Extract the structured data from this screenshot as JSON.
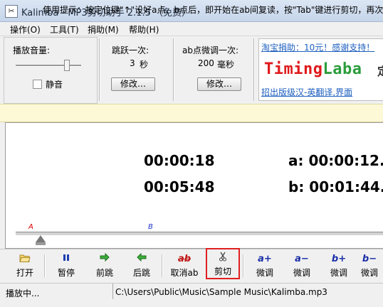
{
  "window": {
    "title": "Kalimba - MP3剪切助手 2.1.5 （免费）",
    "app_icon": "scissors-app-icon"
  },
  "menu": {
    "items": [
      "操作(O)",
      "工具(T)",
      "捐助(M)",
      "帮助(H)"
    ]
  },
  "volume": {
    "label": "播放音量:",
    "mute_label": "静音",
    "level_fraction": 0.78
  },
  "jump": {
    "label": "跳跃一次:",
    "value": "3",
    "unit": "秒",
    "button": "修改…"
  },
  "fine_tune": {
    "label": "ab点微调一次:",
    "value": "200",
    "unit": "毫秒",
    "button": "修改…"
  },
  "ad": {
    "top_link": "淘宝捐助：10元！感谢支持！",
    "logo_part1": "Timing",
    "logo_part2": "Laba",
    "logo_extra": "定",
    "bottom_link": "招出版级汉-英翻译,界面"
  },
  "tip": {
    "text": "使用提示：按定位键\"↑\"设好a点、b点后，即开始在ab间复读，按\"Tab\"键进行剪切，再次"
  },
  "display": {
    "current_time": "00:00:18",
    "total_time": "00:05:48",
    "a_point": "a: 00:00:12.7",
    "b_point": "b: 00:01:44.0"
  },
  "timeline": {
    "a_marker": "A",
    "b_marker": "B"
  },
  "toolbar": {
    "open": "打开",
    "pause": "暂停",
    "forward": "前跳",
    "back": "后跳",
    "cancel_ab": "取消ab",
    "cancel_ab_icon": "ab",
    "cancel_ab_sub": "ab",
    "cut": "剪切",
    "a_plus": "微调",
    "a_plus_icon": "a+",
    "a_minus": "微调",
    "a_minus_icon": "a−",
    "b_plus": "微调",
    "b_plus_icon": "b+",
    "b_minus": "微调",
    "b_minus_icon": "b−"
  },
  "status": {
    "state": "播放中...",
    "path": "C:\\Users\\Public\\Music\\Sample Music\\Kalimba.mp3"
  },
  "colors": {
    "accent_red": "#e02020",
    "tip_bg": "#fdf8d6",
    "link_blue": "#1d5fbf"
  }
}
